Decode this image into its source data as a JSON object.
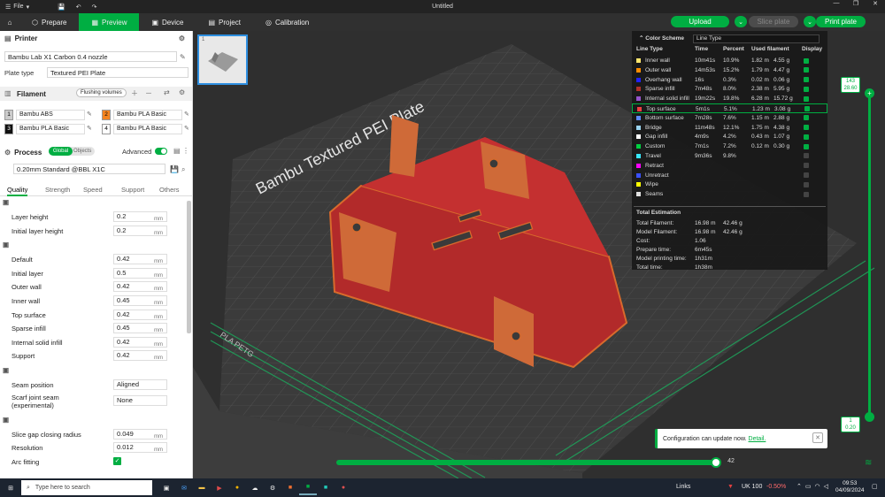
{
  "title_bar": {
    "file_label": "File",
    "window_title": "Untitled"
  },
  "tabs": {
    "prepare": "Prepare",
    "preview": "Preview",
    "device": "Device",
    "project": "Project",
    "calibration": "Calibration"
  },
  "actions": {
    "upload": "Upload",
    "slice_plate": "Slice plate",
    "print_plate": "Print plate"
  },
  "printer": {
    "section_label": "Printer",
    "name": "Bambu Lab X1 Carbon 0.4 nozzle",
    "plate_type_label": "Plate type",
    "plate_type": "Textured PEI Plate"
  },
  "filament": {
    "section_label": "Filament",
    "flushing_button": "Flushing volumes",
    "slots": [
      {
        "num": "1",
        "name": "Bambu ABS",
        "color": "#cccccc"
      },
      {
        "num": "2",
        "name": "Bambu PLA Basic",
        "color": "#f5841f"
      },
      {
        "num": "3",
        "name": "Bambu PLA Basic",
        "color": "#111111"
      },
      {
        "num": "4",
        "name": "Bambu PLA Basic",
        "color": "#ffffff"
      }
    ]
  },
  "process": {
    "section_label": "Process",
    "global": "Global",
    "objects": "Objects",
    "advanced": "Advanced",
    "preset": "0.20mm Standard @BBL X1C",
    "tabs": [
      "Quality",
      "Strength",
      "Speed",
      "Support",
      "Others"
    ]
  },
  "quality": {
    "layer_height": {
      "title": "Layer height",
      "rows": [
        {
          "label": "Layer height",
          "value": "0.2",
          "unit": "mm"
        },
        {
          "label": "Initial layer height",
          "value": "0.2",
          "unit": "mm"
        }
      ]
    },
    "line_width": {
      "title": "Line width",
      "rows": [
        {
          "label": "Default",
          "value": "0.42",
          "unit": "mm"
        },
        {
          "label": "Initial layer",
          "value": "0.5",
          "unit": "mm"
        },
        {
          "label": "Outer wall",
          "value": "0.42",
          "unit": "mm"
        },
        {
          "label": "Inner wall",
          "value": "0.45",
          "unit": "mm"
        },
        {
          "label": "Top surface",
          "value": "0.42",
          "unit": "mm"
        },
        {
          "label": "Sparse infill",
          "value": "0.45",
          "unit": "mm"
        },
        {
          "label": "Internal solid infill",
          "value": "0.42",
          "unit": "mm"
        },
        {
          "label": "Support",
          "value": "0.42",
          "unit": "mm"
        }
      ]
    },
    "seam": {
      "title": "Seam",
      "position_label": "Seam position",
      "position_value": "Aligned",
      "scarf_label_1": "Scarf joint seam",
      "scarf_label_2": "(experimental)",
      "scarf_value": "None"
    },
    "precision": {
      "title": "Precision",
      "rows": [
        {
          "label": "Slice gap closing radius",
          "value": "0.049",
          "unit": "mm"
        },
        {
          "label": "Resolution",
          "value": "0.012",
          "unit": "mm"
        }
      ],
      "arc_label": "Arc fitting"
    }
  },
  "legend": {
    "title": "Color Scheme",
    "dropdown": "Line Type",
    "headers": [
      "Line Type",
      "Time",
      "Percent",
      "Used filament",
      "Display"
    ],
    "rows": [
      {
        "name": "Inner wall",
        "time": "10m41s",
        "percent": "10.9%",
        "m": "1.82 m",
        "g": "4.55 g",
        "color": "#ffe66e",
        "on": true
      },
      {
        "name": "Outer wall",
        "time": "14m53s",
        "percent": "15.2%",
        "m": "1.79 m",
        "g": "4.47 g",
        "color": "#ff8c00",
        "on": true
      },
      {
        "name": "Overhang wall",
        "time": "16s",
        "percent": "0.3%",
        "m": "0.02 m",
        "g": "0.06 g",
        "color": "#2222ff",
        "on": true
      },
      {
        "name": "Sparse infill",
        "time": "7m48s",
        "percent": "8.0%",
        "m": "2.38 m",
        "g": "5.95 g",
        "color": "#b03029",
        "on": true
      },
      {
        "name": "Internal solid infill",
        "time": "19m22s",
        "percent": "19.8%",
        "m": "6.28 m",
        "g": "15.72 g",
        "color": "#9654cc",
        "on": true
      },
      {
        "name": "Top surface",
        "time": "5m1s",
        "percent": "5.1%",
        "m": "1.23 m",
        "g": "3.08 g",
        "color": "#f04040",
        "on": true
      },
      {
        "name": "Bottom surface",
        "time": "7m28s",
        "percent": "7.6%",
        "m": "1.15 m",
        "g": "2.88 g",
        "color": "#5a8aff",
        "on": true
      },
      {
        "name": "Bridge",
        "time": "11m48s",
        "percent": "12.1%",
        "m": "1.75 m",
        "g": "4.38 g",
        "color": "#9ad4f0",
        "on": true
      },
      {
        "name": "Gap infill",
        "time": "4m9s",
        "percent": "4.2%",
        "m": "0.43 m",
        "g": "1.07 g",
        "color": "#ffffff",
        "on": true
      },
      {
        "name": "Custom",
        "time": "7m1s",
        "percent": "7.2%",
        "m": "0.12 m",
        "g": "0.30 g",
        "color": "#00d040",
        "on": true
      },
      {
        "name": "Travel",
        "time": "9m36s",
        "percent": "9.8%",
        "m": "",
        "g": "",
        "color": "#38e8ff",
        "on": false
      },
      {
        "name": "Retract",
        "time": "",
        "percent": "",
        "m": "",
        "g": "",
        "color": "#ff00ff",
        "on": false
      },
      {
        "name": "Unretract",
        "time": "",
        "percent": "",
        "m": "",
        "g": "",
        "color": "#3a50ff",
        "on": false
      },
      {
        "name": "Wipe",
        "time": "",
        "percent": "",
        "m": "",
        "g": "",
        "color": "#ffff00",
        "on": false
      },
      {
        "name": "Seams",
        "time": "",
        "percent": "",
        "m": "",
        "g": "",
        "color": "#e0e0e0",
        "on": false
      }
    ],
    "estimation": {
      "title": "Total Estimation",
      "rows": [
        {
          "label": "Total Filament:",
          "a": "16.98 m",
          "b": "42.46 g"
        },
        {
          "label": "Model Filament:",
          "a": "16.98 m",
          "b": "42.46 g"
        },
        {
          "label": "Cost:",
          "a": "1.06",
          "b": ""
        },
        {
          "label": "Prepare time:",
          "a": "6m45s",
          "b": ""
        },
        {
          "label": "Model printing time:",
          "a": "1h31m",
          "b": ""
        },
        {
          "label": "Total time:",
          "a": "1h38m",
          "b": ""
        }
      ]
    }
  },
  "slider": {
    "top_layer": "143",
    "top_height": "28.60",
    "bottom_layer": "1",
    "bottom_height": "0.20",
    "horizontal_value": "42"
  },
  "plate_text": "Bambu Textured PEI Plate",
  "plate_label": "PLA PETG",
  "notification": {
    "text": "Configuration can update now.",
    "link": "Detail."
  },
  "taskbar": {
    "search": "Type here to search",
    "links": "Links",
    "market": "UK 100",
    "market_change": "-0.50%",
    "time": "09:53",
    "date": "04/09/2024"
  }
}
